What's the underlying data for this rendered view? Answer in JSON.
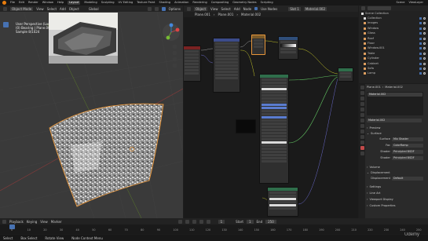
{
  "topbar": {
    "menus": [
      "File",
      "Edit",
      "Render",
      "Window",
      "Help"
    ],
    "tabs": [
      "Layout",
      "Modeling",
      "Sculpting",
      "UV Editing",
      "Texture Paint",
      "Shading",
      "Animation",
      "Rendering",
      "Compositing",
      "Geometry Nodes",
      "Scripting"
    ],
    "active_tab": "Layout",
    "scene": "Scene",
    "view_layer": "ViewLayer"
  },
  "viewport": {
    "mode": "Object Mode",
    "menus": [
      "View",
      "Select",
      "Add",
      "Object"
    ],
    "transform": "Global",
    "options": "Options",
    "overlay_title": "User Perspective (Local)",
    "overlay_object": "(0) Bearing | Plane.001",
    "overlay_sample": "Sample 8/1024"
  },
  "node_editor": {
    "mode": "Object",
    "menus": [
      "View",
      "Select",
      "Add",
      "Node"
    ],
    "use_nodes": "Use Nodes",
    "slot": "Slot 1",
    "material": "Material.002",
    "breadcrumb": [
      "Plane.001",
      "Plane.001",
      "Material.002"
    ]
  },
  "outliner": {
    "title": "Scene Collection",
    "items": [
      "Collection",
      "Images",
      "Window",
      "Glass",
      "Roof",
      "Floor",
      "Window.001",
      "Table",
      "Cylinder",
      "Cabinet",
      "Sofa",
      "Lamp"
    ]
  },
  "properties": {
    "object": "Plane.001",
    "material_tab": "Material.002",
    "material_slot": "Material.002",
    "material_field": "Material.002",
    "sections": {
      "preview": "Preview",
      "surface": "Surface",
      "volume": "Volume",
      "displacement": "Displacement",
      "settings": "Settings",
      "line_art": "Line Art",
      "viewport_display": "Viewport Display",
      "custom_properties": "Custom Properties"
    },
    "surface_label": "Surface",
    "surface_value": "Mix Shader",
    "fac_label": "Fac",
    "fac_value": "ColorRamp",
    "shader_label": "Shader",
    "shader1": "Principled BSDF",
    "shader_label2": "Shader",
    "shader2": "Principled BSDF",
    "displacement_label": "Displacement",
    "displacement_value": "Default"
  },
  "timeline": {
    "menus": [
      "Playback",
      "Keying",
      "View",
      "Marker"
    ],
    "ticks": [
      "0",
      "10",
      "20",
      "30",
      "40",
      "50",
      "60",
      "70",
      "80",
      "90",
      "100",
      "110",
      "120",
      "130",
      "140",
      "150",
      "160",
      "170",
      "180",
      "190",
      "200",
      "210",
      "220",
      "230",
      "240",
      "250"
    ],
    "current_frame": "1",
    "start_label": "Start",
    "start": "1",
    "end_label": "End",
    "end": "250"
  },
  "statusbar": {
    "select": "Select",
    "box_select": "Box Select",
    "rotate_view": "Rotate View",
    "context_menu": "Node Context Menu"
  },
  "watermark": "Udemy",
  "colors": {
    "accent": "#4772b3",
    "node_orange": "#e8963a",
    "ramp_header": "#7a4a2a",
    "shader_header": "#2f6e4b",
    "output_header": "#7a2222",
    "texture_header": "#7a5a2a",
    "ground": "#2f2f2f"
  }
}
